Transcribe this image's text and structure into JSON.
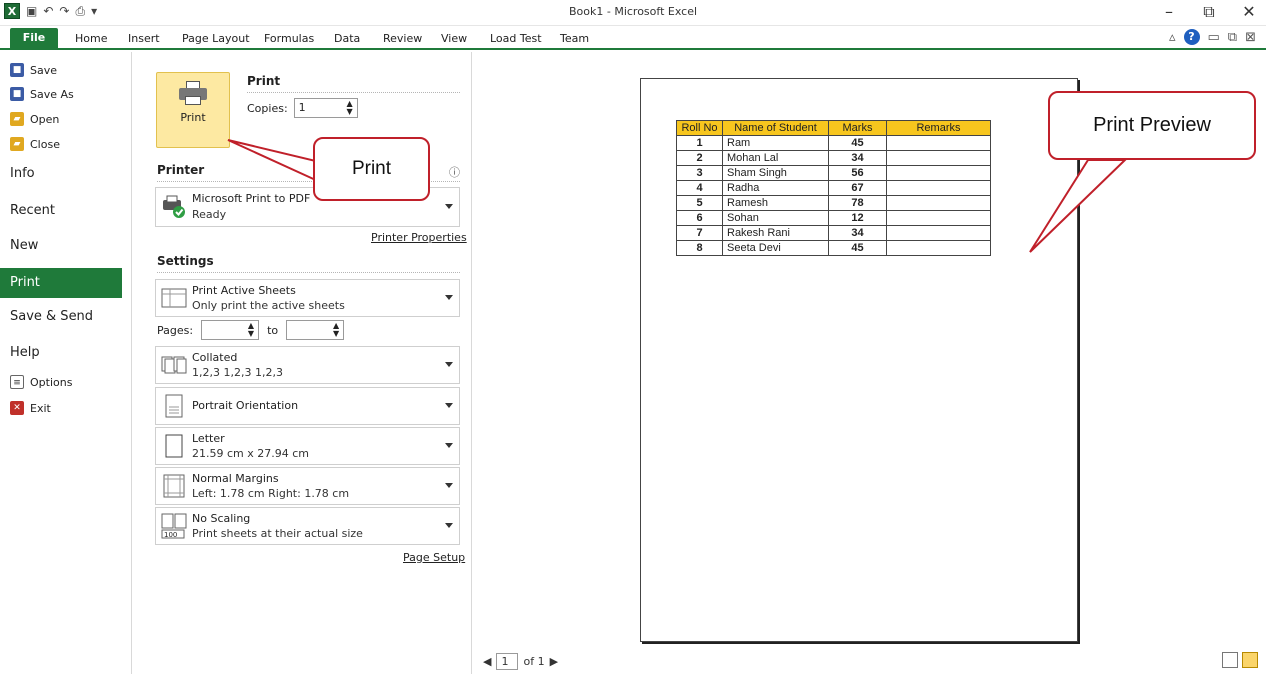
{
  "window": {
    "title": "Book1 - Microsoft Excel",
    "app_icon": "excel-logo",
    "qat_save_icon": "save-icon",
    "qat_undo_icon": "undo-icon",
    "qat_redo_icon": "redo-icon",
    "minimize": "–",
    "maximize": "⧉",
    "close": "✕"
  },
  "ribbon": {
    "tabs": [
      "File",
      "Home",
      "Insert",
      "Page Layout",
      "Formulas",
      "Data",
      "Review",
      "View",
      "Load Test",
      "Team"
    ]
  },
  "nav": {
    "small_items": [
      "Save",
      "Save As",
      "Open",
      "Close"
    ],
    "big_items": [
      "Info",
      "Recent",
      "New"
    ],
    "active": "Print",
    "lower_items": [
      "Save & Send",
      "Help"
    ],
    "bottom_items": [
      "Options",
      "Exit"
    ]
  },
  "print": {
    "section_title": "Print",
    "button_label": "Print",
    "copies_label": "Copies:",
    "copies_value": "1"
  },
  "printer": {
    "section_title": "Printer",
    "name": "Microsoft Print to PDF",
    "status": "Ready",
    "properties_link": "Printer Properties"
  },
  "settings": {
    "section_title": "Settings",
    "what": {
      "title": "Print Active Sheets",
      "subtitle": "Only print the active sheets"
    },
    "pages_label": "Pages:",
    "to_label": "to",
    "collated": {
      "title": "Collated",
      "subtitle": "1,2,3   1,2,3   1,2,3"
    },
    "orientation": {
      "title": "Portrait Orientation"
    },
    "paper": {
      "title": "Letter",
      "subtitle": "21.59 cm x 27.94 cm"
    },
    "margins": {
      "title": "Normal Margins",
      "subtitle": "Left: 1.78 cm   Right: 1.78 cm"
    },
    "scaling": {
      "title": "No Scaling",
      "subtitle": "Print sheets at their actual size",
      "badge": "100"
    },
    "page_setup_link": "Page Setup"
  },
  "callouts": {
    "print": "Print",
    "preview": "Print Preview"
  },
  "sheet": {
    "headers": [
      "Roll No",
      "Name of Student",
      "Marks",
      "Remarks"
    ],
    "rows": [
      {
        "roll": "1",
        "name": "Ram",
        "marks": "45",
        "remarks": ""
      },
      {
        "roll": "2",
        "name": "Mohan Lal",
        "marks": "34",
        "remarks": ""
      },
      {
        "roll": "3",
        "name": "Sham Singh",
        "marks": "56",
        "remarks": ""
      },
      {
        "roll": "4",
        "name": "Radha",
        "marks": "67",
        "remarks": ""
      },
      {
        "roll": "5",
        "name": "Ramesh",
        "marks": "78",
        "remarks": ""
      },
      {
        "roll": "6",
        "name": "Sohan",
        "marks": "12",
        "remarks": ""
      },
      {
        "roll": "7",
        "name": "Rakesh Rani",
        "marks": "34",
        "remarks": ""
      },
      {
        "roll": "8",
        "name": "Seeta Devi",
        "marks": "45",
        "remarks": ""
      }
    ]
  },
  "pager": {
    "current": "1",
    "of_label": "of 1"
  },
  "colors": {
    "file_green": "#1f7a3a",
    "print_button": "#fde9a2",
    "header_fill": "#f7c61e",
    "callout_border": "#c0202a"
  }
}
